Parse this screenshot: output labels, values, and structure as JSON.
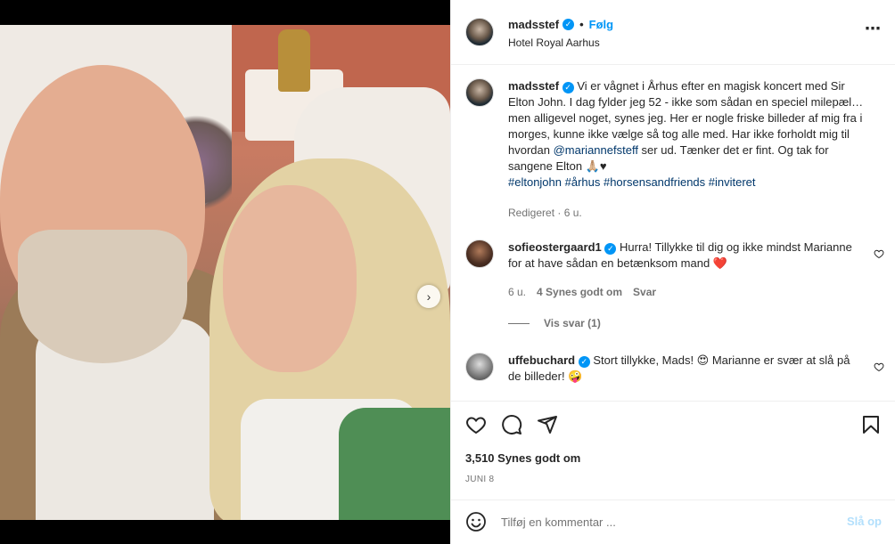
{
  "header": {
    "username": "madsstef",
    "verified_icon": "verified-badge-icon",
    "separator": "•",
    "follow_label": "Følg",
    "location": "Hotel Royal Aarhus",
    "more_label": "⋯"
  },
  "media": {
    "next_label": "›",
    "carousel_count": 4,
    "carousel_active": 1
  },
  "caption": {
    "username": "madsstef",
    "text_1": "Vi er vågnet i Århus efter en magisk koncert med Sir Elton John. I dag fylder jeg 52 - ikke som sådan en speciel milepæl…men alligevel noget, synes jeg. Her er nogle friske billeder af mig fra i morges, kunne ikke vælge så tog alle med. Har ikke forholdt mig til hvordan ",
    "mention": "@mariannefsteff",
    "text_2": " ser ud. Tænker det er fint. Og tak for sangene Elton 🙏🏼♥",
    "hashtags": "#eltonjohn #århus #horsensandfriends #inviteret",
    "edited": "Redigeret · 6 u."
  },
  "comments": [
    {
      "username": "sofieostergaard1",
      "text": "Hurra! Tillykke til dig og ikke mindst Marianne for at have sådan en betænksom mand ❤️",
      "age": "6 u.",
      "likes": "4 Synes godt om",
      "reply": "Svar",
      "view_replies": "Vis svar (1)"
    },
    {
      "username": "uffebuchard",
      "text": "Stort tillykke, Mads! 😍 Marianne er svær at slå på de billeder! 🤪"
    }
  ],
  "actions": {
    "like_icon": "heart-icon",
    "comment_icon": "comment-icon",
    "share_icon": "send-icon",
    "save_icon": "bookmark-icon",
    "likes": "3,510 Synes godt om",
    "date": "JUNI 8"
  },
  "add_comment": {
    "placeholder": "Tilføj en kommentar ...",
    "post_label": "Slå op",
    "emoji_icon": "emoji-icon"
  },
  "colors": {
    "accent": "#0095f6",
    "heart": "#ed4956",
    "post_disabled": "#b2dffc"
  }
}
